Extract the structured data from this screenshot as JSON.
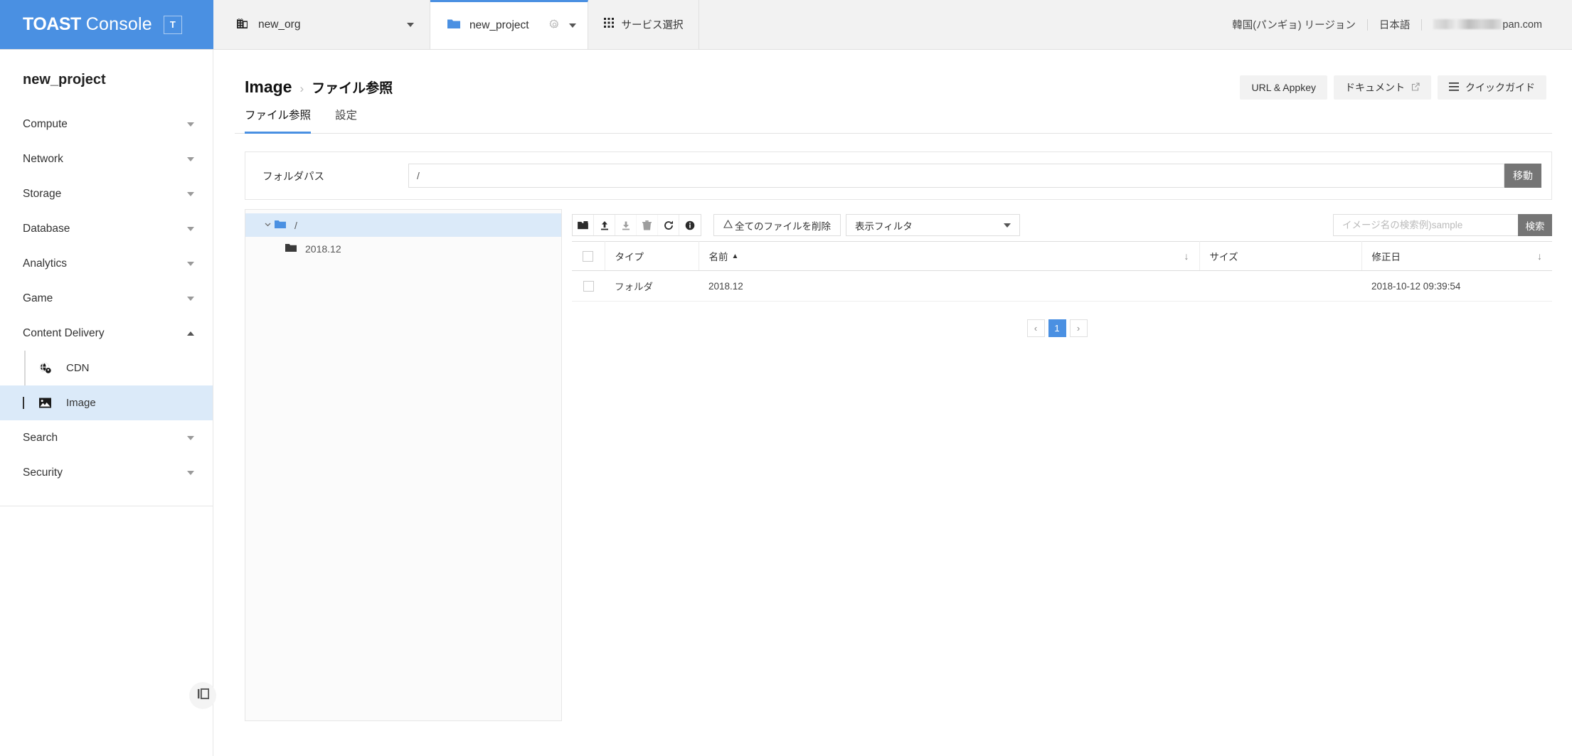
{
  "brand": {
    "toast": "TOAST",
    "console": "Console",
    "badge": "T"
  },
  "topbar": {
    "org_tab": {
      "label": "new_org",
      "icon": "building-icon"
    },
    "project_tab": {
      "label": "new_project",
      "icon": "folder-icon",
      "gear": "gear-icon"
    },
    "service_tab": {
      "label": "サービス選択",
      "icon": "grid-icon"
    },
    "region": "韓国(パンギョ) リージョン",
    "language": "日本語",
    "account": "pan.com"
  },
  "sidebar": {
    "project_name": "new_project",
    "groups": [
      {
        "label": "Compute",
        "expanded": false
      },
      {
        "label": "Network",
        "expanded": false
      },
      {
        "label": "Storage",
        "expanded": false
      },
      {
        "label": "Database",
        "expanded": false
      },
      {
        "label": "Analytics",
        "expanded": false
      },
      {
        "label": "Game",
        "expanded": false
      },
      {
        "label": "Content Delivery",
        "expanded": true
      }
    ],
    "content_delivery_items": [
      {
        "label": "CDN",
        "icon": "globe-pin-icon",
        "active": false
      },
      {
        "label": "Image",
        "icon": "image-icon",
        "active": true
      }
    ],
    "groups_after": [
      {
        "label": "Search",
        "expanded": false
      },
      {
        "label": "Security",
        "expanded": false
      }
    ],
    "collapse_button": "panel-collapse-icon"
  },
  "page": {
    "breadcrumb_main": "Image",
    "breadcrumb_sep": "›",
    "breadcrumb_sub": "ファイル参照",
    "actions": [
      {
        "label": "URL & Appkey",
        "icon": ""
      },
      {
        "label": "ドキュメント",
        "icon": "external-link-icon"
      },
      {
        "label": "クイックガイド",
        "icon": "hamburger-icon"
      }
    ],
    "tabs": [
      {
        "label": "ファイル参照",
        "active": true
      },
      {
        "label": "設定",
        "active": false
      }
    ]
  },
  "path_panel": {
    "label": "フォルダパス",
    "value": "/",
    "go_label": "移動"
  },
  "tree": {
    "root": {
      "label": "/",
      "icon": "folder-open-icon",
      "chevron": "chevron-down-icon",
      "selected": true
    },
    "children": [
      {
        "label": "2018.12",
        "icon": "folder-icon"
      }
    ]
  },
  "toolbar": {
    "icons": [
      {
        "name": "new-folder-icon",
        "enabled": true
      },
      {
        "name": "upload-icon",
        "enabled": true
      },
      {
        "name": "download-icon",
        "enabled": false
      },
      {
        "name": "delete-icon",
        "enabled": false
      },
      {
        "name": "refresh-icon",
        "enabled": true
      },
      {
        "name": "info-icon",
        "enabled": true
      }
    ],
    "delete_all_label": "全てのファイルを削除",
    "delete_all_icon": "warning-icon",
    "filter_label": "表示フィルタ",
    "search_placeholder": "イメージ名の検索例)sample",
    "search_value": "",
    "search_button": "検索"
  },
  "table": {
    "columns": [
      {
        "key": "checkbox",
        "label": ""
      },
      {
        "key": "type",
        "label": "タイプ"
      },
      {
        "key": "name",
        "label": "名前",
        "sorted": "asc",
        "sort_icon": "arrow-down-icon"
      },
      {
        "key": "size",
        "label": "サイズ"
      },
      {
        "key": "date",
        "label": "修正日",
        "sort_icon": "arrow-down-icon"
      }
    ],
    "rows": [
      {
        "type": "フォルダ",
        "name": "2018.12",
        "size": "",
        "date": "2018-10-12 09:39:54",
        "checked": false
      }
    ]
  },
  "pagination": {
    "prev": "‹",
    "next": "›",
    "pages": [
      "1"
    ],
    "current": "1"
  },
  "colors": {
    "brand_blue": "#4a90e2",
    "header_bg": "#f2f2f2",
    "active_row": "#dbeaf9",
    "button_gray": "#757575"
  }
}
